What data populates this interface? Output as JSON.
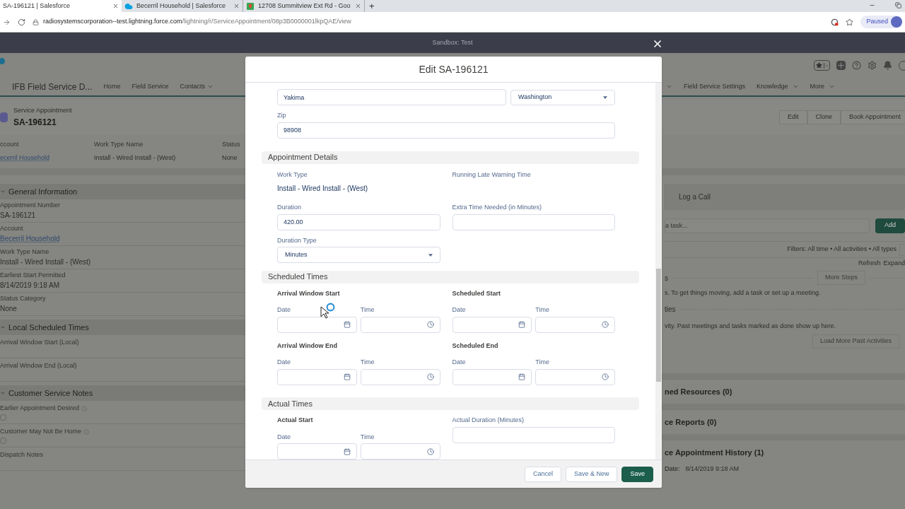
{
  "browser": {
    "tabs": [
      {
        "title": "SA-196121 | Salesforce",
        "selected": true,
        "kind": "plain"
      },
      {
        "title": "Becerril Household | Salesforce",
        "selected": false,
        "kind": "cloud"
      },
      {
        "title": "12708 Summitview Ext Rd - Goo",
        "selected": false,
        "kind": "map"
      }
    ],
    "new_tab": "+",
    "url_host": "radiosystemscorporation--test.lightning.force.com",
    "url_path": "/lightning/r/ServiceAppointment/08p3B0000001lkpQAE/view",
    "profile_status": "Paused"
  },
  "sandbox_bar": {
    "label": "Sandbox: Test"
  },
  "app": {
    "name": "IFB Field Service D...",
    "nav_left": [
      {
        "label": "Home",
        "has_menu": false
      },
      {
        "label": "Field Service",
        "has_menu": false
      },
      {
        "label": "Contacts",
        "has_menu": true
      }
    ],
    "nav_right": [
      {
        "label": "Field Service Settings",
        "has_menu": false
      },
      {
        "label": "Knowledge",
        "has_menu": true
      },
      {
        "label": "More",
        "has_menu": true
      }
    ]
  },
  "record": {
    "type": "Service Appointment",
    "title": "SA-196121",
    "actions": [
      "Edit",
      "Clone",
      "Book Appointment"
    ],
    "highlights": [
      {
        "label": "ccount",
        "value": "ecerril Household",
        "kind": "link"
      },
      {
        "label": "Work Type Name",
        "value": "Install - Wired Install - (West)",
        "kind": "text"
      },
      {
        "label": "Status",
        "value": "None",
        "kind": "text"
      }
    ]
  },
  "left_sections": [
    {
      "title": "General Information",
      "expanded": true,
      "fields": [
        {
          "label": "Appointment Number",
          "value": "SA-196121",
          "kind": "text",
          "info": false
        },
        {
          "label": "Account",
          "value": "Becerril Household",
          "kind": "link",
          "info": false
        },
        {
          "label": "Work Type Name",
          "value": "Install - Wired Install - (West)",
          "kind": "text",
          "info": false
        },
        {
          "label": "Earliest Start Permitted",
          "value": "8/14/2019 9:18 AM",
          "kind": "text",
          "info": false
        },
        {
          "label": "Status Category",
          "value": "None",
          "kind": "text",
          "info": false
        }
      ]
    },
    {
      "title": "Local Scheduled Times",
      "expanded": true,
      "fields": [
        {
          "label": "Arrival Window Start (Local)",
          "kind": "empty",
          "info": false
        },
        {
          "label": "Arrival Window End (Local)",
          "kind": "empty",
          "info": false
        }
      ]
    },
    {
      "title": "Customer Service Notes",
      "expanded": true,
      "fields": [
        {
          "label": "Earlier Appointment Desired",
          "kind": "checkbox",
          "checked": false,
          "info": true
        },
        {
          "label": "Customer May Not Be Home",
          "kind": "checkbox",
          "checked": false,
          "info": true
        },
        {
          "label": "Dispatch Notes",
          "kind": "empty",
          "info": false
        }
      ]
    }
  ],
  "activity": {
    "tabs": [
      {
        "label": "Log a Call",
        "selected": false
      }
    ],
    "task_placeholder": "a task...",
    "add": "Add",
    "filters": "Filters: All time • All activities • All types",
    "links": [
      "Refresh",
      "Expand"
    ],
    "upcoming_label": "s",
    "more_steps": "More Steps",
    "upcoming_text": "s. To get things moving, add a task or set up a meeting.",
    "past_label": "ties",
    "past_text": "vity. Past meetings and tasks marked as done show up here.",
    "load_more": "Load More Past Activities"
  },
  "related": [
    {
      "title": "ned Resources (0)"
    },
    {
      "title": "ce Reports (0)"
    },
    {
      "title": "ce Appointment History (1)"
    }
  ],
  "history": {
    "label": "Date:",
    "value": "8/14/2019 9:18 AM"
  },
  "modal": {
    "title": "Edit SA-196121",
    "city": {
      "value": "Yakima"
    },
    "state": {
      "value": "Washington"
    },
    "zip": {
      "label": "Zip",
      "value": "98908"
    },
    "appointment_details": {
      "title": "Appointment Details",
      "work_type": {
        "label": "Work Type",
        "value": "Install - Wired Install - (West)"
      },
      "running_late": {
        "label": "Running Late Warning Time"
      },
      "duration": {
        "label": "Duration",
        "value": "420.00"
      },
      "extra_time": {
        "label": "Extra Time Needed (in Minutes)"
      },
      "duration_type": {
        "label": "Duration Type",
        "value": "Minutes"
      }
    },
    "scheduled_times": {
      "title": "Scheduled Times",
      "groups": [
        {
          "title": "Arrival Window Start",
          "date_label": "Date",
          "time_label": "Time"
        },
        {
          "title": "Scheduled Start",
          "date_label": "Date",
          "time_label": "Time"
        },
        {
          "title": "Arrival Window End",
          "date_label": "Date",
          "time_label": "Time"
        },
        {
          "title": "Scheduled End",
          "date_label": "Date",
          "time_label": "Time"
        }
      ]
    },
    "actual_times": {
      "title": "Actual Times",
      "start": {
        "title": "Actual Start",
        "date_label": "Date",
        "time_label": "Time"
      },
      "duration": {
        "label": "Actual Duration (Minutes)"
      }
    },
    "buttons": [
      {
        "label": "Cancel",
        "kind": "neutral"
      },
      {
        "label": "Save & New",
        "kind": "neutral"
      },
      {
        "label": "Save",
        "kind": "brand"
      }
    ]
  }
}
